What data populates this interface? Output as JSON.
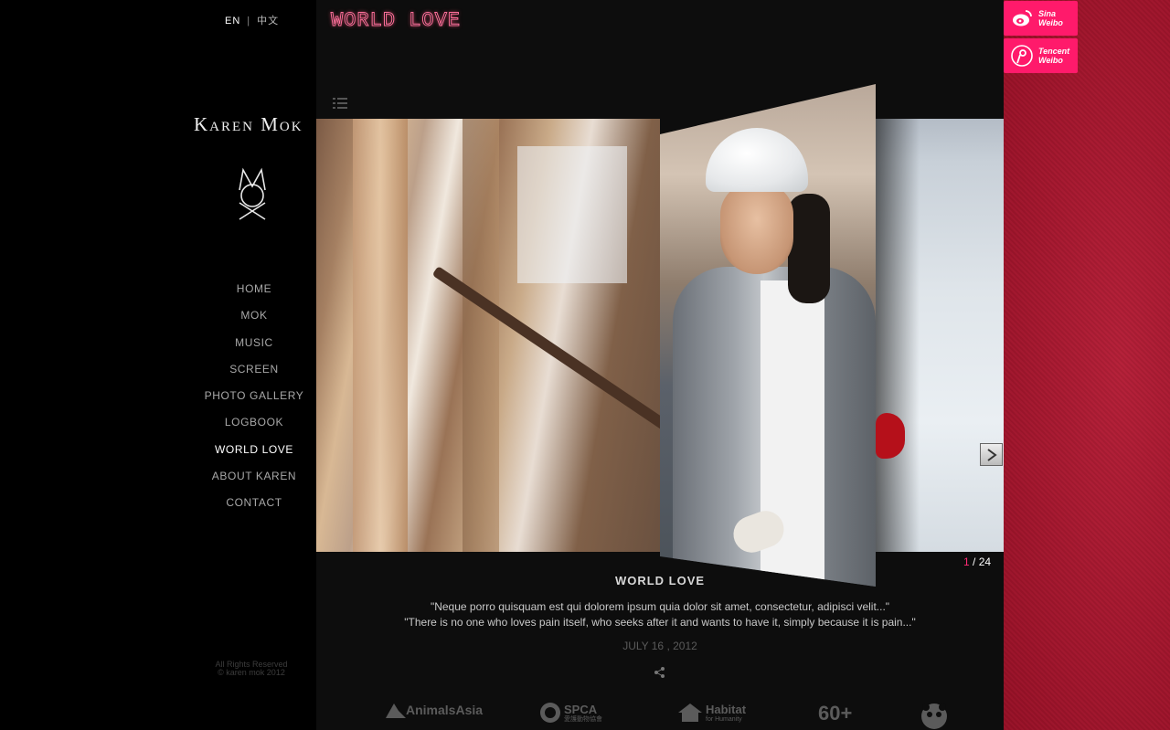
{
  "language": {
    "en": "EN",
    "zh": "中文"
  },
  "brand": {
    "name": "Karen Mok",
    "monogram_icon": "km-monogram-icon"
  },
  "nav": {
    "items": [
      {
        "label": "HOME"
      },
      {
        "label": "MOK"
      },
      {
        "label": "MUSIC"
      },
      {
        "label": "SCREEN"
      },
      {
        "label": "PHOTO GALLERY"
      },
      {
        "label": "LOGBOOK"
      },
      {
        "label": "WORLD LOVE",
        "active": true
      },
      {
        "label": "ABOUT KAREN"
      },
      {
        "label": "CONTACT"
      }
    ]
  },
  "footer": {
    "rights": "All Rights Reserved",
    "copyright": "© karen mok 2012"
  },
  "page": {
    "logo_text": "WORLD LOVE"
  },
  "gallery": {
    "current": "1",
    "total": "/ 24",
    "title": "WORLD LOVE",
    "quote_line1": "\"Neque porro quisquam est qui dolorem ipsum quia dolor sit amet, consectetur, adipisci velit...\"",
    "quote_line2": "\"There is no one who loves pain itself, who seeks after it and wants to have it, simply because it is pain...\"",
    "date": "JULY 16 , 2012"
  },
  "partners": {
    "animals_asia": "AnimalsAsia",
    "spca": "SPCA",
    "spca_sub": "愛護動物協會",
    "habitat": "Habitat",
    "habitat_sub": "for Humanity",
    "earth_hour": "60+"
  },
  "social": {
    "sina_line1": "Sina",
    "sina_line2": "Weibo",
    "tencent_line1": "Tencent",
    "tencent_line2": "Weibo"
  },
  "colors": {
    "accent": "#ff1a6b",
    "counter_current": "#ff2b74",
    "background_red": "#b21630"
  }
}
